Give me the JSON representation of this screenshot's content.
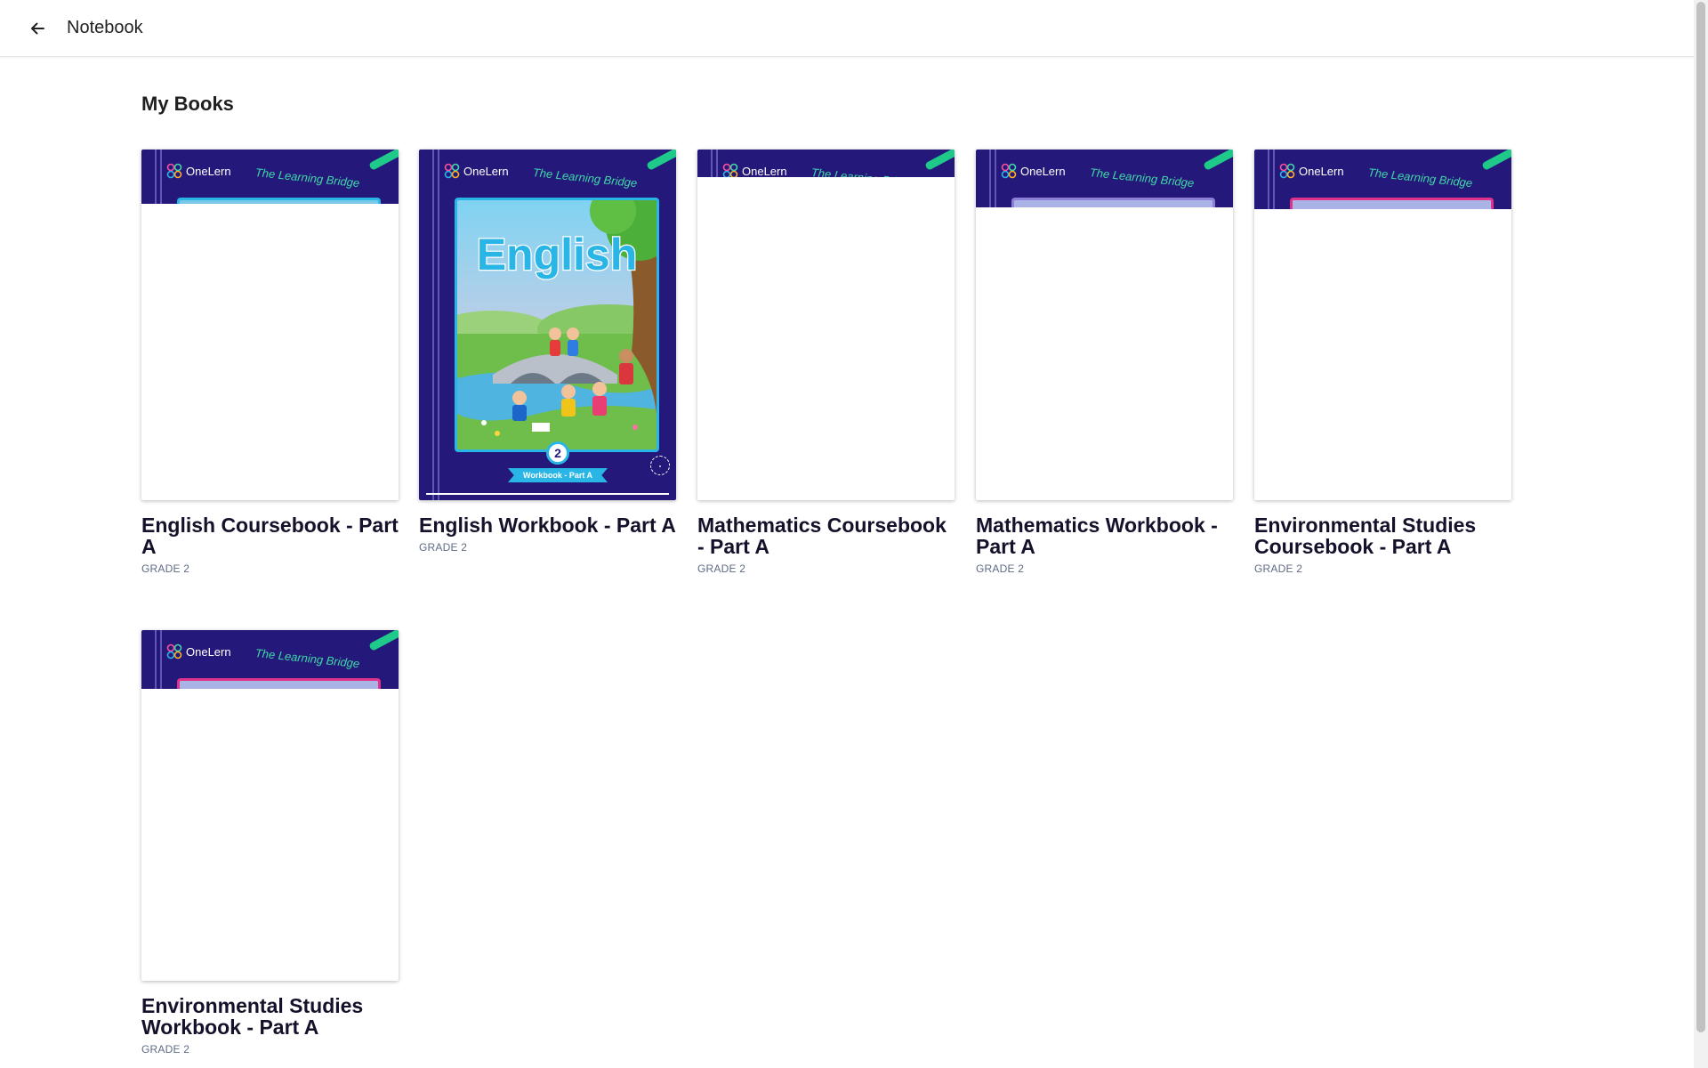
{
  "header": {
    "title": "Notebook",
    "back_icon": "arrow-left-icon"
  },
  "section": {
    "title": "My Books"
  },
  "brand": {
    "publisher": "OneLern",
    "tagline": "The Learning Bridge",
    "primary_color": "#24197a",
    "accent_color": "#29b6e6",
    "tagline_color": "#41d8a7"
  },
  "books": [
    {
      "title": "English Coursebook - Part A",
      "grade": "GRADE 2",
      "cover_loaded": false
    },
    {
      "title": "English Workbook - Part A",
      "grade": "GRADE 2",
      "cover_loaded": true,
      "cover": {
        "subject": "English",
        "grade_number": "2",
        "ribbon": "Workbook - Part A"
      },
      "reading_progress": 1.0
    },
    {
      "title": "Mathematics Coursebook - Part A",
      "grade": "GRADE 2",
      "cover_loaded": false
    },
    {
      "title": "Mathematics Workbook - Part A",
      "grade": "GRADE 2",
      "cover_loaded": false
    },
    {
      "title": "Environmental Studies Coursebook - Part A",
      "grade": "GRADE 2",
      "cover_loaded": false
    },
    {
      "title": "Environmental Studies Workbook - Part A",
      "grade": "GRADE 2",
      "cover_loaded": false
    }
  ]
}
